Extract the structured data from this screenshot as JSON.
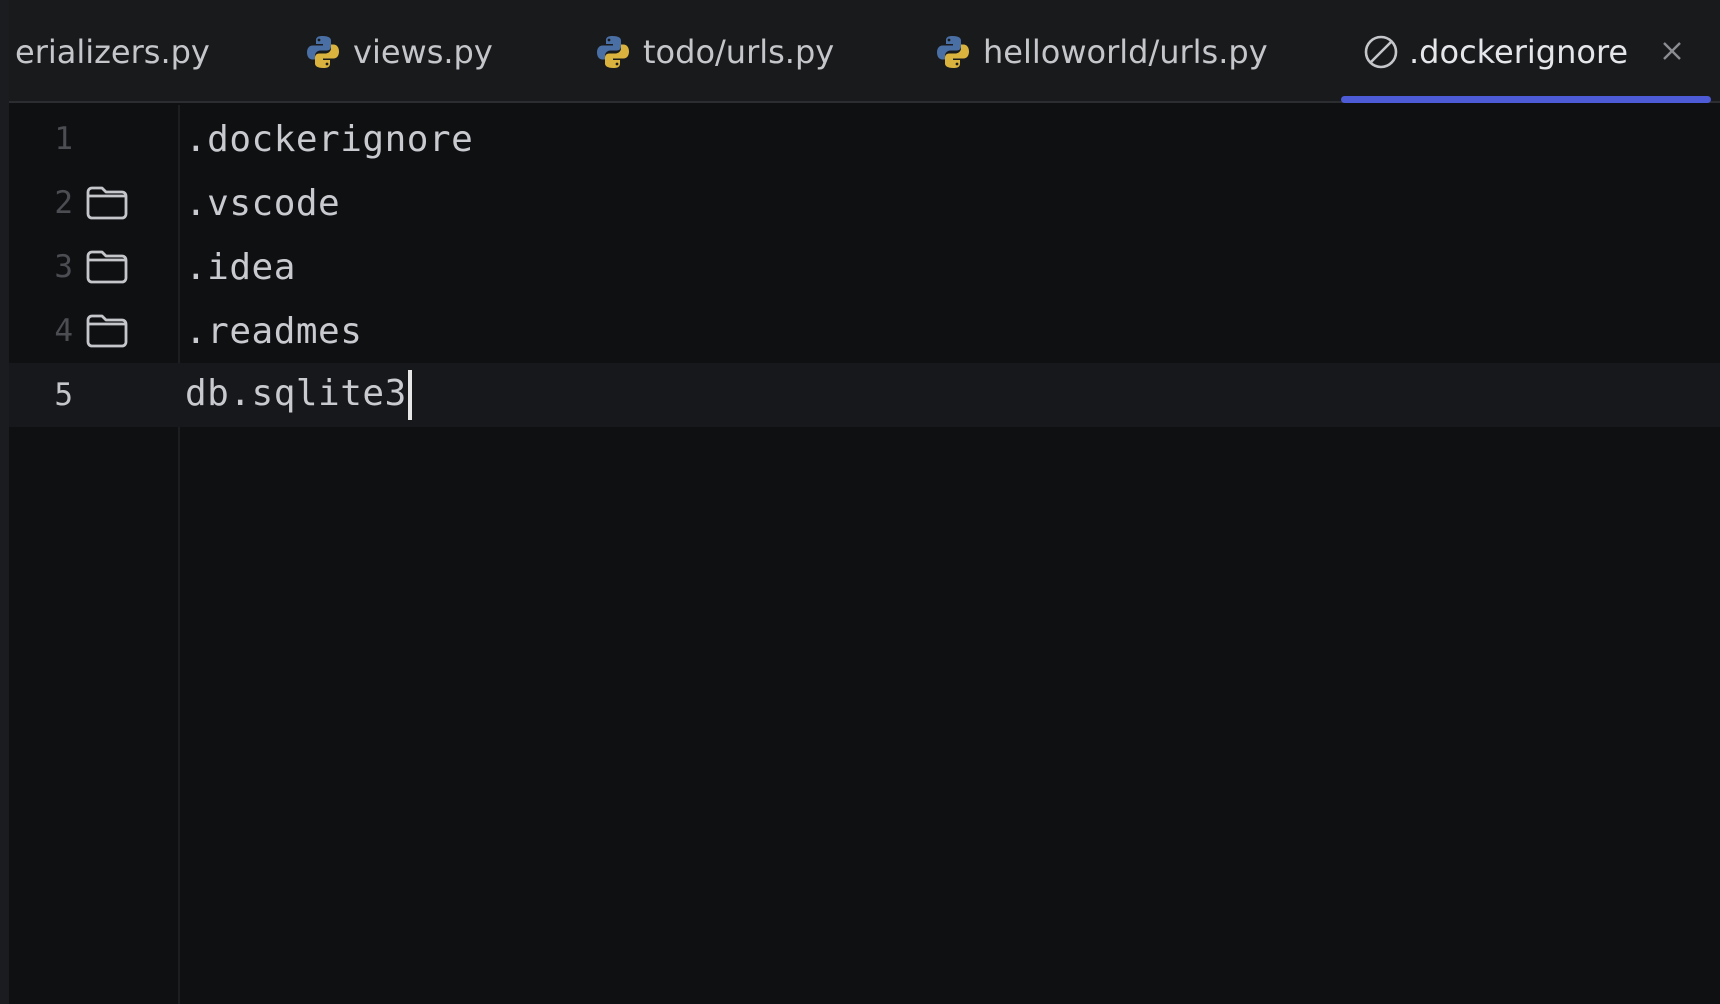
{
  "tabs": [
    {
      "label": "erializers.py",
      "icon": "none"
    },
    {
      "label": "views.py",
      "icon": "python-icon"
    },
    {
      "label": "todo/urls.py",
      "icon": "python-icon"
    },
    {
      "label": "helloworld/urls.py",
      "icon": "python-icon"
    },
    {
      "label": ".dockerignore",
      "icon": "ignore-file-icon",
      "active": true
    }
  ],
  "colors": {
    "accent": "#4d5bd6",
    "python_blue": "#4a6fa5",
    "python_yellow": "#d9b33e"
  },
  "editor": {
    "lines": [
      {
        "number": "1",
        "text": ".dockerignore",
        "folder": false
      },
      {
        "number": "2",
        "text": ".vscode",
        "folder": true
      },
      {
        "number": "3",
        "text": ".idea",
        "folder": true
      },
      {
        "number": "4",
        "text": ".readmes",
        "folder": true
      },
      {
        "number": "5",
        "text": "db.sqlite3",
        "folder": false,
        "current": true
      }
    ]
  }
}
